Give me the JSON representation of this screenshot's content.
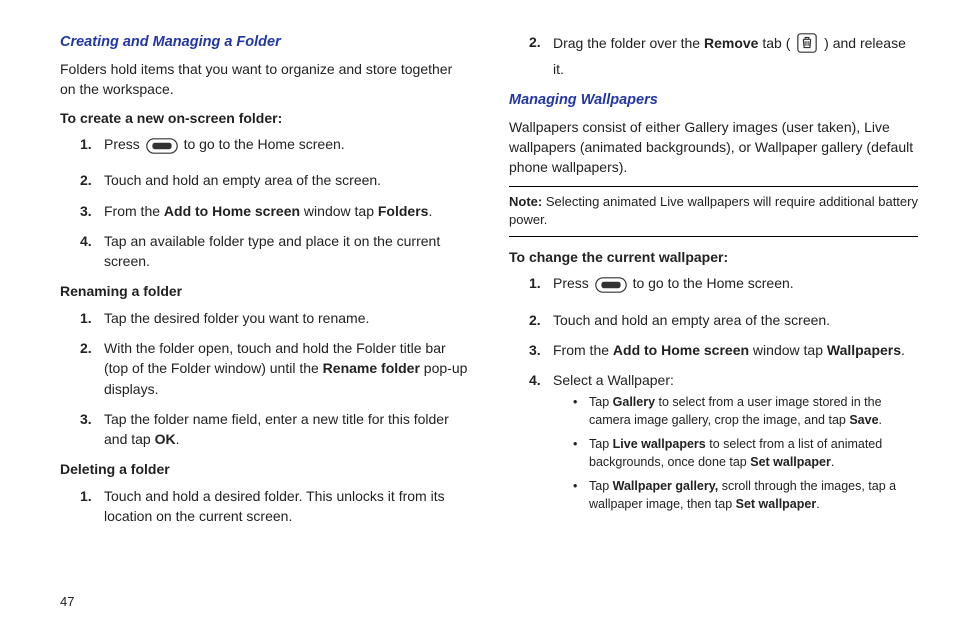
{
  "pageNumber": "47",
  "left": {
    "heading": "Creating and Managing a Folder",
    "intro": "Folders hold items that you want to organize and store together on the workspace.",
    "create": {
      "title": "To create a new on-screen folder:",
      "s1a": "Press ",
      "s1b": " to go to the Home screen.",
      "s2": "Touch and hold an empty area of the screen.",
      "s3a": "From the ",
      "s3b": "Add to Home screen",
      "s3c": " window tap ",
      "s3d": "Folders",
      "s3e": ".",
      "s4": "Tap an available folder type and place it on the current screen."
    },
    "rename": {
      "title": "Renaming a folder",
      "s1": "Tap the desired folder you want to rename.",
      "s2a": "With the folder open, touch and hold the Folder title bar (top of the Folder window) until the ",
      "s2b": "Rename folder",
      "s2c": " pop-up displays.",
      "s3a": "Tap the folder name field, enter a new title for this folder and tap ",
      "s3b": "OK",
      "s3c": "."
    },
    "delete": {
      "title": "Deleting a folder",
      "s1": "Touch and hold a desired folder. This unlocks it from its location on the current screen."
    }
  },
  "right": {
    "delete_s2a": "Drag the folder over the ",
    "delete_s2b": "Remove",
    "delete_s2c": " tab ( ",
    "delete_s2d": " ) and release it.",
    "heading": "Managing Wallpapers",
    "intro": "Wallpapers consist of either Gallery images (user taken), Live wallpapers (animated backgrounds), or Wallpaper gallery (default phone wallpapers).",
    "note_label": "Note:",
    "note_text": " Selecting animated Live wallpapers will require additional battery power.",
    "change": {
      "title": "To change the current wallpaper:",
      "s1a": "Press ",
      "s1b": " to go to the Home screen.",
      "s2": "Touch and hold an empty area of the screen.",
      "s3a": "From the ",
      "s3b": "Add to Home screen",
      "s3c": " window tap ",
      "s3d": "Wallpapers",
      "s3e": ".",
      "s4": "Select a Wallpaper:",
      "b1a": "Tap ",
      "b1b": "Gallery",
      "b1c": " to select from a user image stored in the camera image gallery, crop the image, and tap ",
      "b1d": "Save",
      "b1e": ".",
      "b2a": "Tap ",
      "b2b": "Live wallpapers",
      "b2c": " to select from a list of animated backgrounds, once done tap ",
      "b2d": "Set wallpaper",
      "b2e": ".",
      "b3a": "Tap ",
      "b3b": "Wallpaper gallery,",
      "b3c": " scroll through the images, tap a wallpaper image, then tap ",
      "b3d": "Set wallpaper",
      "b3e": "."
    }
  }
}
